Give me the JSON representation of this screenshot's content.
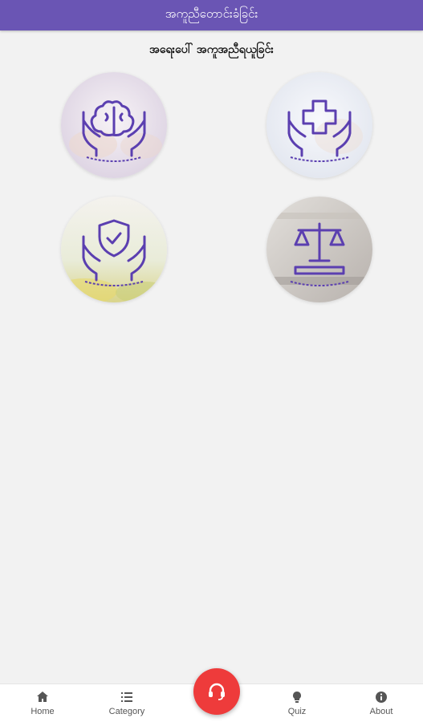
{
  "app_bar": {
    "title": "အကူညီတောင်းခံခြင်း"
  },
  "section": {
    "title": "အရေးပေါ် အကူအညီရယူခြင်း"
  },
  "tiles": [
    {
      "icon": "brain-hands-icon",
      "background": "#e9e3ef"
    },
    {
      "icon": "medical-cross-hands-icon",
      "background": "#eef0f6"
    },
    {
      "icon": "shield-check-hands-icon",
      "background": "#e7edd8"
    },
    {
      "icon": "justice-scales-hands-icon",
      "background": "#cfcac6"
    }
  ],
  "bottom_nav": {
    "items": [
      {
        "label": "Home",
        "icon": "home-icon"
      },
      {
        "label": "Category",
        "icon": "list-icon"
      },
      {
        "label": "Quiz",
        "icon": "lightbulb-icon"
      },
      {
        "label": "About",
        "icon": "info-icon"
      }
    ],
    "fab_icon": "headset-icon"
  },
  "colors": {
    "primary": "#6a55b4",
    "icon_stroke": "#5b3fb0",
    "fab": "#ee3b3b",
    "background": "#f2f2f2"
  }
}
